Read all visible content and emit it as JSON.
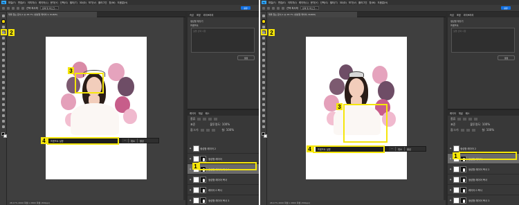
{
  "menubar": {
    "logo": "Ps",
    "items": [
      "파일(F)",
      "편집(E)",
      "이미지(I)",
      "레이어(L)",
      "문자(Y)",
      "선택(S)",
      "필터(T)",
      "3D(D)",
      "보기(V)",
      "플러그인",
      "창(W)",
      "도움말(H)"
    ]
  },
  "options": {
    "label": "선택 피사체",
    "mode_label": "선택 및 마스크...",
    "share_label": "공유"
  },
  "panel": {
    "tabs": [
      "속성",
      "조정",
      "라이브러리"
    ],
    "props_title": "생성형 채우기",
    "prompt_label": "프롬프트",
    "prompt_placeholder": "설명 선택 사항",
    "generate_label": "생성"
  },
  "layers_panel": {
    "tabs": [
      "레이어",
      "채널",
      "패스"
    ],
    "kind_label": "종류",
    "blend_mode": "표준",
    "opacity_label": "불투명도: 100%",
    "lock_label": "잠그기:",
    "fill_label": "칠: 100%"
  },
  "left": {
    "doc_tab": "제목 없는 문서-1 @ 28.7% (생성형 레이어 2, RGB/8)",
    "status": "28.17%    2000 픽셀 x 2800 픽셀 (300ppi)",
    "layers": [
      {
        "name": "생성형 레이어 2",
        "type": "group"
      },
      {
        "name": "생성형 레이어",
        "type": "layer"
      },
      {
        "name": "생성형 레이어 복사 2",
        "type": "layer"
      },
      {
        "name": "생성형 레이어 복사",
        "type": "layer"
      },
      {
        "name": "레이어 0 복사",
        "type": "layer"
      },
      {
        "name": "생성형 레이어 복사 3",
        "type": "layer"
      }
    ],
    "ctx_field": "프롬프트 설명",
    "ctx_more": "···",
    "ctx_cancel": "취소",
    "ctx_generate": "생성"
  },
  "right": {
    "doc_tab": "제목 없는 문서-1 @ 28.7% (생성형 레이어, RGB/8)",
    "status": "28.17%    2000 픽셀 x 2800 픽셀 (300ppi)",
    "layers": [
      {
        "name": "생성형 레이어 2",
        "type": "group"
      },
      {
        "name": "생성형 레이어",
        "type": "layer"
      },
      {
        "name": "생성형 레이어 복사 2",
        "type": "layer"
      },
      {
        "name": "생성형 레이어 복사",
        "type": "layer"
      },
      {
        "name": "레이어 0 복사",
        "type": "layer"
      },
      {
        "name": "생성형 레이어 복사 3",
        "type": "layer"
      }
    ],
    "ctx_field": "프롬프트 설명",
    "ctx_more": "···",
    "ctx_cancel": "취소",
    "ctx_generate": "생성"
  },
  "badges": {
    "n1": "1",
    "n2": "2",
    "n3": "3",
    "n4": "4"
  },
  "colors": {
    "highlight": "#f5e60a",
    "share": "#1473e6",
    "panel": "#383838"
  }
}
